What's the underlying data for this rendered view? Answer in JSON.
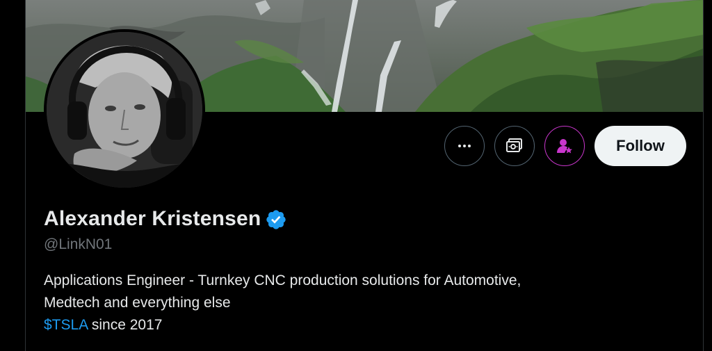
{
  "profile": {
    "name": "Alexander Kristensen",
    "handle": "@LinkN01",
    "bio_line1": "Applications Engineer - Turnkey CNC production solutions for Automotive,",
    "bio_line2": "Medtech and everything else",
    "cashtag": "$TSLA",
    "bio_line3_rest": " since 2017"
  },
  "actions": {
    "more_icon": "more-horizontal-icon",
    "tip_icon": "money-tip-icon",
    "subscribe_icon": "subscribe-person-star-icon",
    "follow_label": "Follow"
  },
  "colors": {
    "background": "#000000",
    "text_primary": "#e7e9ea",
    "text_secondary": "#71767b",
    "link": "#1d9bf0",
    "verified": "#1d9bf0",
    "subscribe_accent": "#c936cc",
    "follow_button_bg": "#eff3f4"
  }
}
